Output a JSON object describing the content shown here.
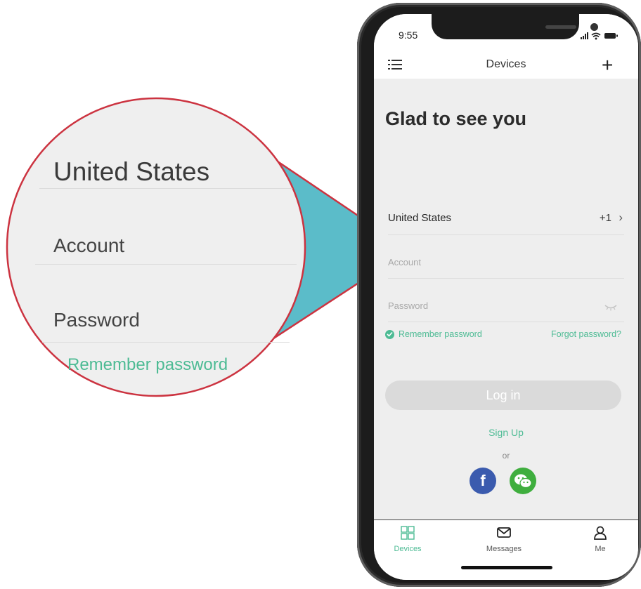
{
  "callout": {
    "country": "United States",
    "account": "Account",
    "password": "Password",
    "remember": "Remember password"
  },
  "status_bar": {
    "time": "9:55"
  },
  "nav": {
    "title": "Devices",
    "menu_icon": "list-icon",
    "add_icon": "plus-icon",
    "add_label": "+"
  },
  "login": {
    "greeting": "Glad to see you",
    "country": "United States",
    "dial_code": "+1",
    "chevron": "›",
    "account_placeholder": "Account",
    "password_placeholder": "Password",
    "remember_label": "Remember password",
    "remember_checked": true,
    "forgot_label": "Forgot password?",
    "login_button": "Log in",
    "signup_label": "Sign Up",
    "or_label": "or",
    "facebook_letter": "f"
  },
  "tabs": [
    {
      "label": "Devices",
      "icon": "grid-icon",
      "active": true
    },
    {
      "label": "Messages",
      "icon": "message-icon",
      "active": false
    },
    {
      "label": "Me",
      "icon": "person-icon",
      "active": false
    }
  ],
  "colors": {
    "accent": "#4dbb94",
    "callout_fill": "#5bbcc9",
    "callout_border": "#cc3340",
    "facebook": "#3b5bae",
    "wechat": "#3fae3e",
    "login_disabled": "#dadada"
  }
}
